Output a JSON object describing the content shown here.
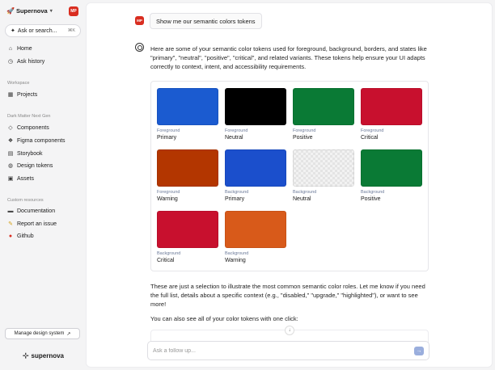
{
  "sidebar": {
    "brand": "Supernova",
    "avatar_initials": "MP",
    "ask": {
      "label": "Ask or search...",
      "shortcut": "⌘K"
    },
    "top_items": [
      {
        "label": "Home",
        "icon": "home-icon"
      },
      {
        "label": "Ask history",
        "icon": "history-icon"
      }
    ],
    "workspace_label": "Workspace",
    "workspace_items": [
      {
        "label": "Projects",
        "icon": "projects-icon"
      }
    ],
    "ds_label": "Dark Matter Next Gen",
    "ds_items": [
      {
        "label": "Components",
        "icon": "components-icon"
      },
      {
        "label": "Figma components",
        "icon": "figma-icon"
      },
      {
        "label": "Storybook",
        "icon": "storybook-icon"
      },
      {
        "label": "Design tokens",
        "icon": "tokens-icon"
      },
      {
        "label": "Assets",
        "icon": "assets-icon"
      }
    ],
    "custom_label": "Custom resources",
    "custom_items": [
      {
        "label": "Documentation",
        "icon": "documentation-icon"
      },
      {
        "label": "Report an issue",
        "icon": "report-icon"
      },
      {
        "label": "Github",
        "icon": "github-icon"
      }
    ],
    "manage_label": "Manage design system",
    "footer_brand": "supernova"
  },
  "chat": {
    "user_initials": "MP",
    "user_message": "Show me our semantic colors tokens",
    "intro": "Here are some of your semantic color tokens used for foreground, background, borders, and states like \"primary\", \"neutral\", \"positive\", \"critical\", and related variants. These tokens help ensure your UI adapts correctly to context, intent, and accessibility requirements.",
    "tokens": [
      {
        "category": "Foreground",
        "name": "Primary",
        "color": "#1b5bd0"
      },
      {
        "category": "Foreground",
        "name": "Neutral",
        "color": "#000000"
      },
      {
        "category": "Foreground",
        "name": "Positive",
        "color": "#0a7a35"
      },
      {
        "category": "Foreground",
        "name": "Critical",
        "color": "#c8102e"
      },
      {
        "category": "Foreground",
        "name": "Warning",
        "color": "#b33600"
      },
      {
        "category": "Background",
        "name": "Primary",
        "color": "#1b4fcc"
      },
      {
        "category": "Background",
        "name": "Neutral",
        "color": "checker"
      },
      {
        "category": "Background",
        "name": "Positive",
        "color": "#0a7a35"
      },
      {
        "category": "Background",
        "name": "Critical",
        "color": "#c8102e"
      },
      {
        "category": "Background",
        "name": "Warning",
        "color": "#d85a1a"
      }
    ],
    "outro": "These are just a selection to illustrate the most common semantic color roles. Let me know if you need the full list, details about a specific context (e.g., \"disabled,\" \"upgrade,\" \"highlighted\"), or want to see more!",
    "one_click": "You can also see all of your color tokens with one click:",
    "followup_placeholder": "Ask a follow up..."
  }
}
